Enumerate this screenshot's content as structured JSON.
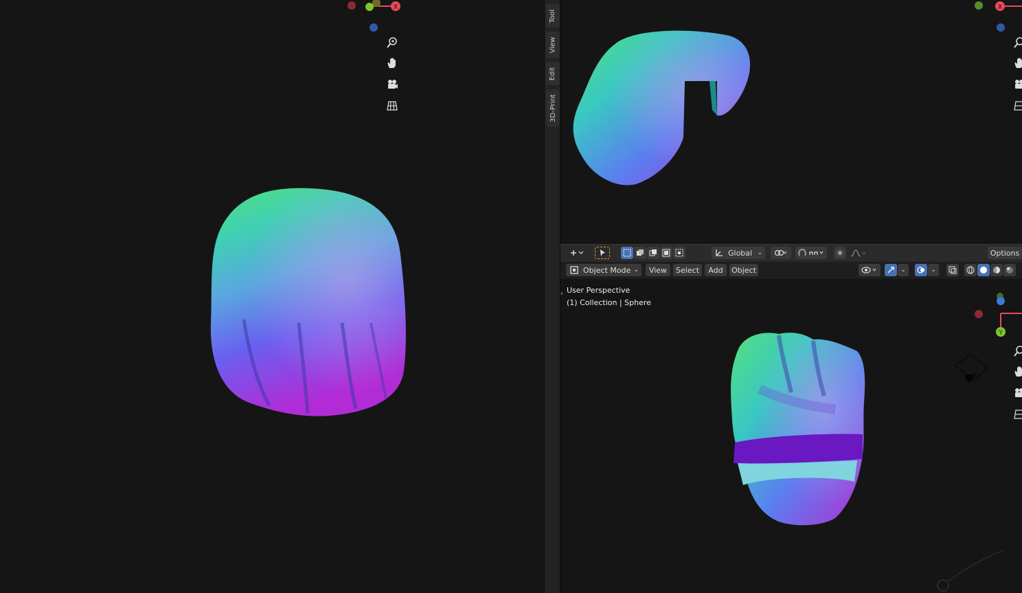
{
  "sidebar": {
    "tabs": [
      "Tool",
      "View",
      "Edit",
      "3D-Print"
    ]
  },
  "toolbar": {
    "orientation_label": "Global",
    "options_label": "Options"
  },
  "viewport_header": {
    "mode_label": "Object Mode",
    "menu": [
      "View",
      "Select",
      "Add",
      "Object"
    ]
  },
  "viewport_bottom_right": {
    "perspective_label": "User Perspective",
    "collection_label": "(1) Collection | Sphere"
  },
  "gizmo": {
    "x_label": "X",
    "y_label": "Y",
    "x_color": "#e94a5c",
    "y_color": "#7ec42b",
    "z_color": "#3b7bd8"
  },
  "nav_icons": [
    "zoom-icon",
    "hand-pan-icon",
    "camera-icon",
    "grid-ortho-icon"
  ]
}
